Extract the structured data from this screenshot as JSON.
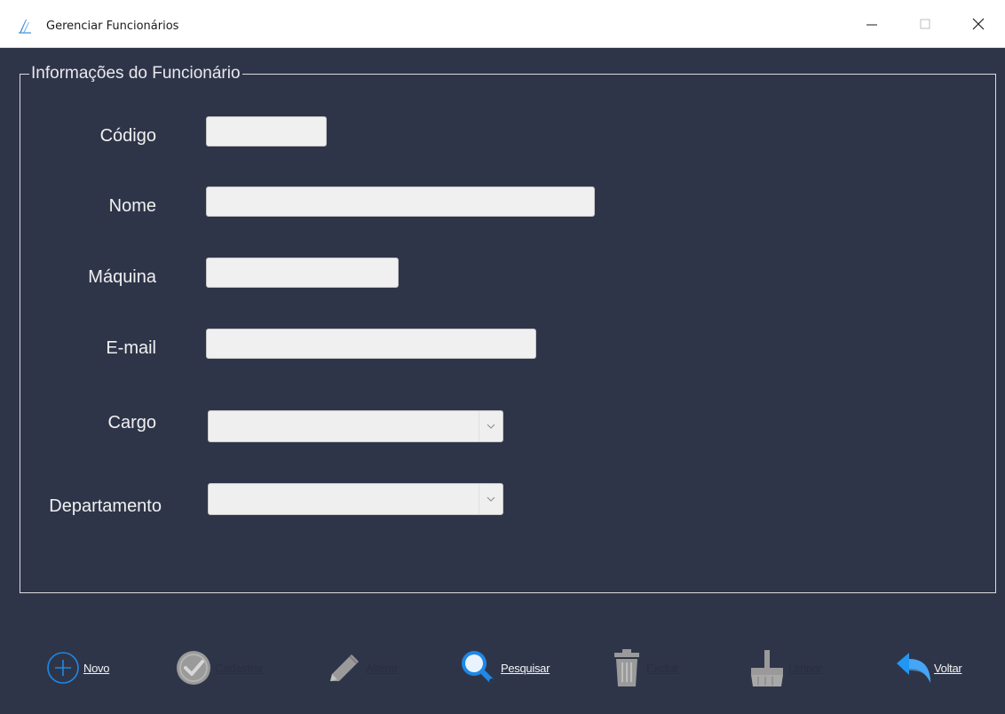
{
  "window": {
    "title": "Gerenciar Funcionários",
    "controls": [
      "minimize",
      "maximize",
      "close"
    ]
  },
  "group": {
    "legend": "Informações do Funcionário"
  },
  "form": {
    "codigo": {
      "label": "Código",
      "value": ""
    },
    "nome": {
      "label": "Nome",
      "value": ""
    },
    "maquina": {
      "label": "Máquina",
      "value": ""
    },
    "email": {
      "label": "E-mail",
      "value": ""
    },
    "cargo": {
      "label": "Cargo",
      "selected": ""
    },
    "departamento": {
      "label": "Departamento",
      "selected": ""
    }
  },
  "toolbar": {
    "novo": {
      "label": "Novo",
      "icon": "plus-circle-icon",
      "enabled": true
    },
    "cadastrar": {
      "label": "Cadastrar",
      "icon": "check-circle-icon",
      "enabled": false
    },
    "alterar": {
      "label": "Alterar",
      "icon": "pencil-icon",
      "enabled": false
    },
    "pesquisar": {
      "label": "Pesquisar",
      "icon": "magnifier-icon",
      "enabled": true
    },
    "excluir": {
      "label": "Excluir",
      "icon": "trash-icon",
      "enabled": false
    },
    "limpar": {
      "label": "Limpar",
      "icon": "broom-icon",
      "enabled": false
    },
    "voltar": {
      "label": "Voltar",
      "icon": "undo-arrow-icon",
      "enabled": true
    }
  },
  "colors": {
    "background": "#2f3549",
    "accent_blue": "#1e88e5",
    "disabled_icon": "#9a9a9a"
  }
}
